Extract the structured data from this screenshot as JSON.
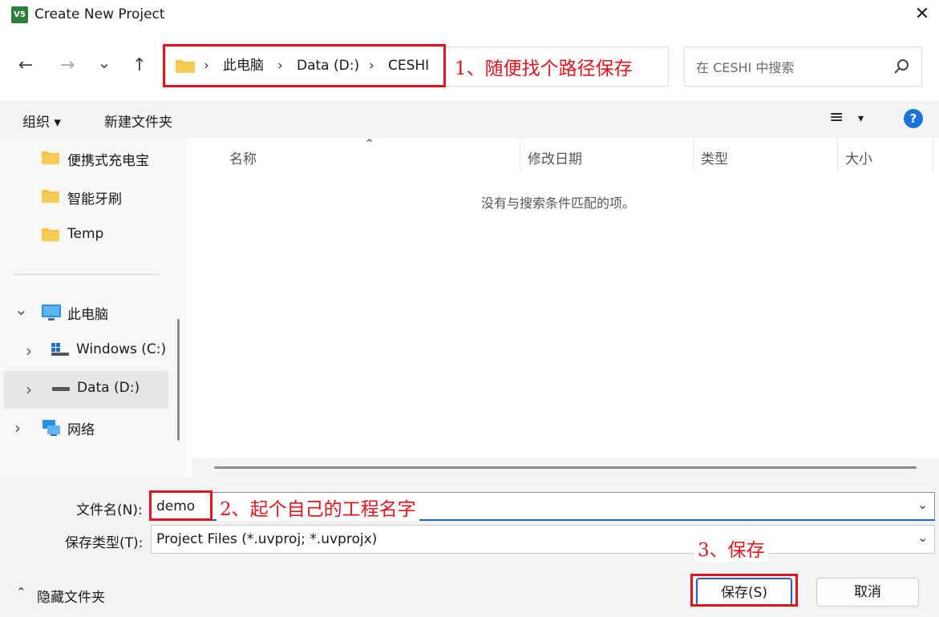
{
  "window": {
    "title": "Create New Project",
    "icon_text": "V5",
    "close": "✕"
  },
  "nav": {
    "back": "←",
    "forward": "→",
    "recent": "⌄",
    "up": "↑"
  },
  "breadcrumbs": [
    "此电脑",
    "Data (D:)",
    "CESHI"
  ],
  "breadcrumb_sep": "›",
  "search": {
    "placeholder": "在 CESHI 中搜索"
  },
  "toolbar": {
    "organize": "组织 ▾",
    "new_folder": "新建文件夹",
    "view": "≡",
    "view_dd": "▾",
    "help": "?"
  },
  "sidebar": {
    "folders": [
      "便携式充电宝",
      "智能牙刷",
      "Temp"
    ],
    "this_pc": "此电脑",
    "windows": "Windows (C:)",
    "data": "Data (D:)",
    "network": "网络",
    "chev_down": "⌄",
    "chev_right": "›"
  },
  "columns": {
    "name": "名称",
    "modified": "修改日期",
    "type": "类型",
    "size": "大小",
    "sort": "⌃"
  },
  "empty_message": "没有与搜索条件匹配的项。",
  "filename": {
    "label": "文件名(N):",
    "value": "demo"
  },
  "filetype": {
    "label": "保存类型(T):",
    "value": "Project Files (*.uvproj; *.uvprojx)"
  },
  "hide_folders": "隐藏文件夹",
  "hide_chevron": "⌃",
  "dropdown_arrow": "⌄",
  "buttons": {
    "save": "保存(S)",
    "cancel": "取消"
  },
  "annotations": {
    "step1": "1、随便找个路径保存",
    "step2": "2、起个自己的工程名字",
    "step3": "3、保存"
  },
  "colors": {
    "accent": "#1a66c4",
    "annotation": "#e3141b",
    "folder": "#f5c242"
  }
}
